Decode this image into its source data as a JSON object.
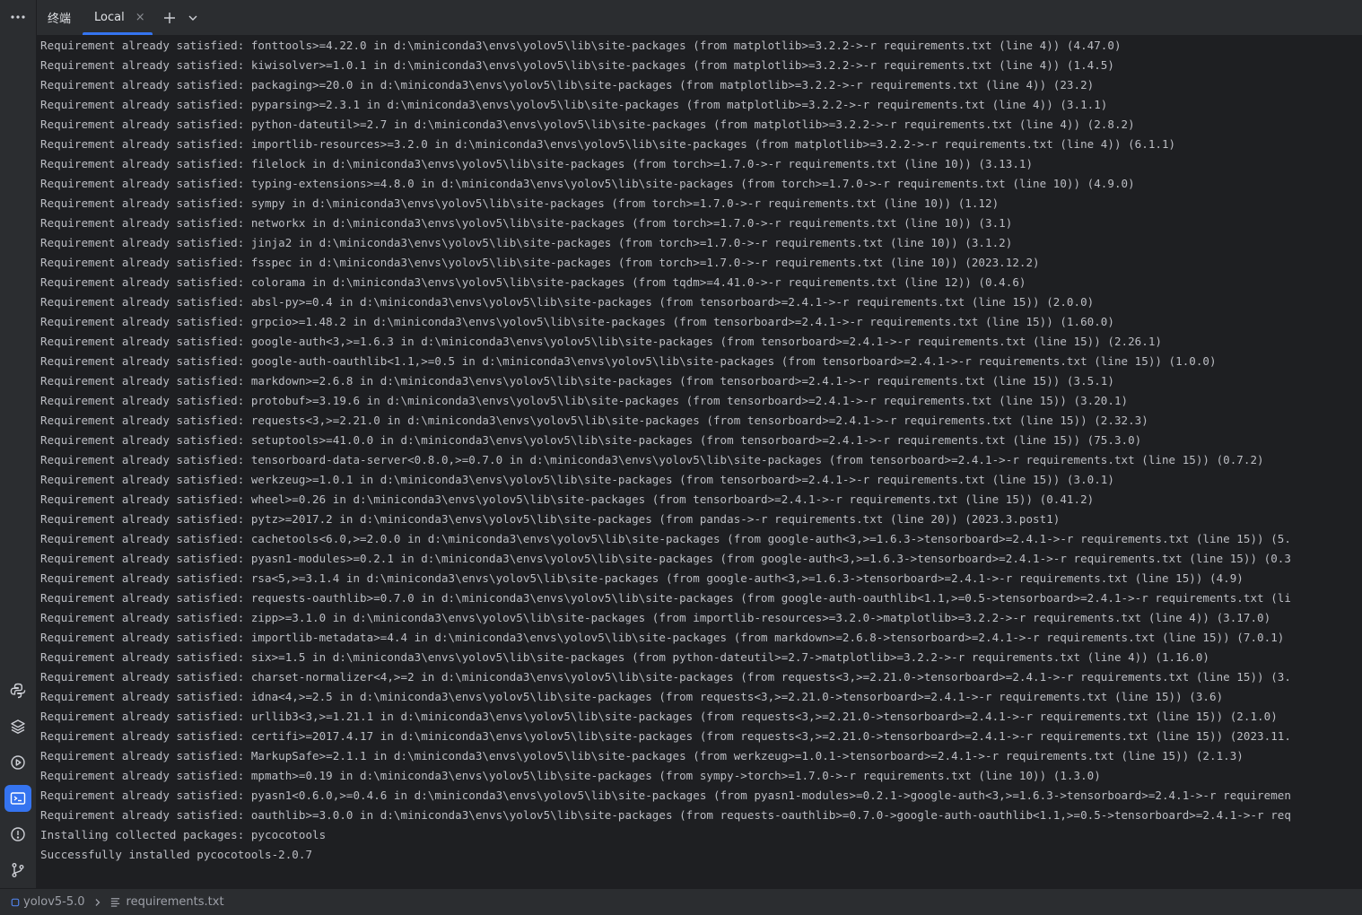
{
  "toolwindow": {
    "title": "终端",
    "tabs": [
      {
        "label": "Local",
        "close_glyph": "×"
      }
    ],
    "new_tab_icon": "plus-icon",
    "dropdown_icon": "chevron-down-icon",
    "menu_icon": "more-horizontal-icon"
  },
  "sidebar": {
    "icons": [
      "python-console-icon",
      "layers-icon",
      "services-icon",
      "terminal-icon",
      "problems-icon",
      "git-icon"
    ],
    "active": "terminal-icon"
  },
  "terminal": {
    "lines": [
      "Requirement already satisfied: fonttools>=4.22.0 in d:\\miniconda3\\envs\\yolov5\\lib\\site-packages (from matplotlib>=3.2.2->-r requirements.txt (line 4)) (4.47.0)",
      "Requirement already satisfied: kiwisolver>=1.0.1 in d:\\miniconda3\\envs\\yolov5\\lib\\site-packages (from matplotlib>=3.2.2->-r requirements.txt (line 4)) (1.4.5)",
      "Requirement already satisfied: packaging>=20.0 in d:\\miniconda3\\envs\\yolov5\\lib\\site-packages (from matplotlib>=3.2.2->-r requirements.txt (line 4)) (23.2)",
      "Requirement already satisfied: pyparsing>=2.3.1 in d:\\miniconda3\\envs\\yolov5\\lib\\site-packages (from matplotlib>=3.2.2->-r requirements.txt (line 4)) (3.1.1)",
      "Requirement already satisfied: python-dateutil>=2.7 in d:\\miniconda3\\envs\\yolov5\\lib\\site-packages (from matplotlib>=3.2.2->-r requirements.txt (line 4)) (2.8.2)",
      "Requirement already satisfied: importlib-resources>=3.2.0 in d:\\miniconda3\\envs\\yolov5\\lib\\site-packages (from matplotlib>=3.2.2->-r requirements.txt (line 4)) (6.1.1)",
      "Requirement already satisfied: filelock in d:\\miniconda3\\envs\\yolov5\\lib\\site-packages (from torch>=1.7.0->-r requirements.txt (line 10)) (3.13.1)",
      "Requirement already satisfied: typing-extensions>=4.8.0 in d:\\miniconda3\\envs\\yolov5\\lib\\site-packages (from torch>=1.7.0->-r requirements.txt (line 10)) (4.9.0)",
      "Requirement already satisfied: sympy in d:\\miniconda3\\envs\\yolov5\\lib\\site-packages (from torch>=1.7.0->-r requirements.txt (line 10)) (1.12)",
      "Requirement already satisfied: networkx in d:\\miniconda3\\envs\\yolov5\\lib\\site-packages (from torch>=1.7.0->-r requirements.txt (line 10)) (3.1)",
      "Requirement already satisfied: jinja2 in d:\\miniconda3\\envs\\yolov5\\lib\\site-packages (from torch>=1.7.0->-r requirements.txt (line 10)) (3.1.2)",
      "Requirement already satisfied: fsspec in d:\\miniconda3\\envs\\yolov5\\lib\\site-packages (from torch>=1.7.0->-r requirements.txt (line 10)) (2023.12.2)",
      "Requirement already satisfied: colorama in d:\\miniconda3\\envs\\yolov5\\lib\\site-packages (from tqdm>=4.41.0->-r requirements.txt (line 12)) (0.4.6)",
      "Requirement already satisfied: absl-py>=0.4 in d:\\miniconda3\\envs\\yolov5\\lib\\site-packages (from tensorboard>=2.4.1->-r requirements.txt (line 15)) (2.0.0)",
      "Requirement already satisfied: grpcio>=1.48.2 in d:\\miniconda3\\envs\\yolov5\\lib\\site-packages (from tensorboard>=2.4.1->-r requirements.txt (line 15)) (1.60.0)",
      "Requirement already satisfied: google-auth<3,>=1.6.3 in d:\\miniconda3\\envs\\yolov5\\lib\\site-packages (from tensorboard>=2.4.1->-r requirements.txt (line 15)) (2.26.1)",
      "Requirement already satisfied: google-auth-oauthlib<1.1,>=0.5 in d:\\miniconda3\\envs\\yolov5\\lib\\site-packages (from tensorboard>=2.4.1->-r requirements.txt (line 15)) (1.0.0)",
      "Requirement already satisfied: markdown>=2.6.8 in d:\\miniconda3\\envs\\yolov5\\lib\\site-packages (from tensorboard>=2.4.1->-r requirements.txt (line 15)) (3.5.1)",
      "Requirement already satisfied: protobuf>=3.19.6 in d:\\miniconda3\\envs\\yolov5\\lib\\site-packages (from tensorboard>=2.4.1->-r requirements.txt (line 15)) (3.20.1)",
      "Requirement already satisfied: requests<3,>=2.21.0 in d:\\miniconda3\\envs\\yolov5\\lib\\site-packages (from tensorboard>=2.4.1->-r requirements.txt (line 15)) (2.32.3)",
      "Requirement already satisfied: setuptools>=41.0.0 in d:\\miniconda3\\envs\\yolov5\\lib\\site-packages (from tensorboard>=2.4.1->-r requirements.txt (line 15)) (75.3.0)",
      "Requirement already satisfied: tensorboard-data-server<0.8.0,>=0.7.0 in d:\\miniconda3\\envs\\yolov5\\lib\\site-packages (from tensorboard>=2.4.1->-r requirements.txt (line 15)) (0.7.2)",
      "Requirement already satisfied: werkzeug>=1.0.1 in d:\\miniconda3\\envs\\yolov5\\lib\\site-packages (from tensorboard>=2.4.1->-r requirements.txt (line 15)) (3.0.1)",
      "Requirement already satisfied: wheel>=0.26 in d:\\miniconda3\\envs\\yolov5\\lib\\site-packages (from tensorboard>=2.4.1->-r requirements.txt (line 15)) (0.41.2)",
      "Requirement already satisfied: pytz>=2017.2 in d:\\miniconda3\\envs\\yolov5\\lib\\site-packages (from pandas->-r requirements.txt (line 20)) (2023.3.post1)",
      "Requirement already satisfied: cachetools<6.0,>=2.0.0 in d:\\miniconda3\\envs\\yolov5\\lib\\site-packages (from google-auth<3,>=1.6.3->tensorboard>=2.4.1->-r requirements.txt (line 15)) (5.",
      "Requirement already satisfied: pyasn1-modules>=0.2.1 in d:\\miniconda3\\envs\\yolov5\\lib\\site-packages (from google-auth<3,>=1.6.3->tensorboard>=2.4.1->-r requirements.txt (line 15)) (0.3",
      "Requirement already satisfied: rsa<5,>=3.1.4 in d:\\miniconda3\\envs\\yolov5\\lib\\site-packages (from google-auth<3,>=1.6.3->tensorboard>=2.4.1->-r requirements.txt (line 15)) (4.9)",
      "Requirement already satisfied: requests-oauthlib>=0.7.0 in d:\\miniconda3\\envs\\yolov5\\lib\\site-packages (from google-auth-oauthlib<1.1,>=0.5->tensorboard>=2.4.1->-r requirements.txt (li",
      "Requirement already satisfied: zipp>=3.1.0 in d:\\miniconda3\\envs\\yolov5\\lib\\site-packages (from importlib-resources>=3.2.0->matplotlib>=3.2.2->-r requirements.txt (line 4)) (3.17.0)",
      "Requirement already satisfied: importlib-metadata>=4.4 in d:\\miniconda3\\envs\\yolov5\\lib\\site-packages (from markdown>=2.6.8->tensorboard>=2.4.1->-r requirements.txt (line 15)) (7.0.1)",
      "Requirement already satisfied: six>=1.5 in d:\\miniconda3\\envs\\yolov5\\lib\\site-packages (from python-dateutil>=2.7->matplotlib>=3.2.2->-r requirements.txt (line 4)) (1.16.0)",
      "Requirement already satisfied: charset-normalizer<4,>=2 in d:\\miniconda3\\envs\\yolov5\\lib\\site-packages (from requests<3,>=2.21.0->tensorboard>=2.4.1->-r requirements.txt (line 15)) (3.",
      "Requirement already satisfied: idna<4,>=2.5 in d:\\miniconda3\\envs\\yolov5\\lib\\site-packages (from requests<3,>=2.21.0->tensorboard>=2.4.1->-r requirements.txt (line 15)) (3.6)",
      "Requirement already satisfied: urllib3<3,>=1.21.1 in d:\\miniconda3\\envs\\yolov5\\lib\\site-packages (from requests<3,>=2.21.0->tensorboard>=2.4.1->-r requirements.txt (line 15)) (2.1.0)",
      "Requirement already satisfied: certifi>=2017.4.17 in d:\\miniconda3\\envs\\yolov5\\lib\\site-packages (from requests<3,>=2.21.0->tensorboard>=2.4.1->-r requirements.txt (line 15)) (2023.11.",
      "Requirement already satisfied: MarkupSafe>=2.1.1 in d:\\miniconda3\\envs\\yolov5\\lib\\site-packages (from werkzeug>=1.0.1->tensorboard>=2.4.1->-r requirements.txt (line 15)) (2.1.3)",
      "Requirement already satisfied: mpmath>=0.19 in d:\\miniconda3\\envs\\yolov5\\lib\\site-packages (from sympy->torch>=1.7.0->-r requirements.txt (line 10)) (1.3.0)",
      "Requirement already satisfied: pyasn1<0.6.0,>=0.4.6 in d:\\miniconda3\\envs\\yolov5\\lib\\site-packages (from pyasn1-modules>=0.2.1->google-auth<3,>=1.6.3->tensorboard>=2.4.1->-r requiremen",
      "Requirement already satisfied: oauthlib>=3.0.0 in d:\\miniconda3\\envs\\yolov5\\lib\\site-packages (from requests-oauthlib>=0.7.0->google-auth-oauthlib<1.1,>=0.5->tensorboard>=2.4.1->-r req",
      "Installing collected packages: pycocotools",
      "Successfully installed pycocotools-2.0.7"
    ]
  },
  "statusbar": {
    "project": "yolov5-5.0",
    "file": "requirements.txt",
    "project_icon": "module-icon",
    "separator_icon": "chevron-right-icon",
    "file_icon": "text-file-icon"
  },
  "colors": {
    "background": "#1e1f22",
    "panel": "#2b2d30",
    "text": "#bcbec4",
    "accent": "#3574f0"
  }
}
